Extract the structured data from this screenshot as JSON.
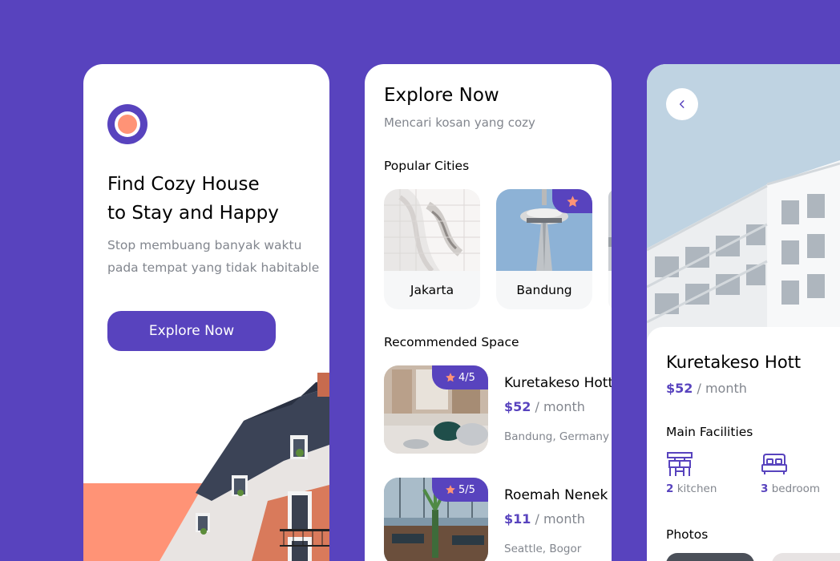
{
  "colors": {
    "primary": "#5843BE",
    "accent": "#FF9376",
    "text_grey": "#82868E",
    "card_bg": "#FFFFFF",
    "chip_bg": "#F6F7F8"
  },
  "onboarding": {
    "logo_icon": "app-logo-icon",
    "title_line1": "Find Cozy House",
    "title_line2": "to Stay and Happy",
    "subtitle_line1": "Stop membuang banyak waktu",
    "subtitle_line2": "pada tempat yang tidak habitable",
    "cta_label": "Explore Now"
  },
  "explore": {
    "title": "Explore Now",
    "subtitle": "Mencari kosan yang cozy",
    "popular_label": "Popular Cities",
    "cities": [
      {
        "name": "Jakarta",
        "popular": false
      },
      {
        "name": "Bandung",
        "popular": true
      }
    ],
    "recommended_label": "Recommended Space",
    "spaces": [
      {
        "name": "Kuretakeso Hott",
        "rating": "4/5",
        "price": "$52",
        "period": " / month",
        "location": "Bandung, Germany"
      },
      {
        "name": "Roemah Nenek",
        "rating": "5/5",
        "price": "$11",
        "period": " / month",
        "location": "Seattle, Bogor"
      }
    ]
  },
  "detail": {
    "back_icon": "chevron-left-icon",
    "name": "Kuretakeso Hott",
    "price": "$52",
    "period": " / month",
    "facilities_label": "Main Facilities",
    "facilities": [
      {
        "count": "2",
        "label": " kitchen",
        "icon": "kitchen-icon"
      },
      {
        "count": "3",
        "label": " bedroom",
        "icon": "bed-icon"
      }
    ],
    "photos_label": "Photos"
  }
}
